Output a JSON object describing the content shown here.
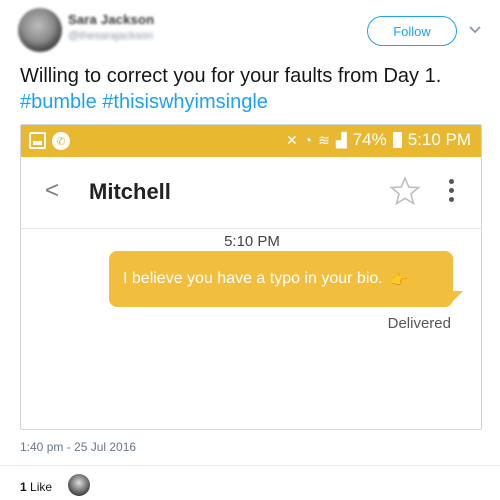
{
  "tweet": {
    "display_name": "Sara Jackson",
    "username": "@thesarajackson",
    "follow_label": "Follow",
    "text_before": "Willing to correct you for your faults from Day 1. ",
    "hashtags": [
      "#bumble",
      "#thisiswhyimsingle"
    ],
    "timestamp": "1:40 pm - 25 Jul 2016",
    "likes_count": "1",
    "likes_label": "Like"
  },
  "screenshot": {
    "status_bar": {
      "battery": "74%",
      "time": "5:10 PM",
      "color": "#e8b830"
    },
    "chat": {
      "contact_name": "Mitchell",
      "back_icon": "chevron-left-icon",
      "message_time": "5:10 PM",
      "message": "I believe you have a typo in your bio.",
      "bubble_color": "#f1be3e",
      "status": "Delivered"
    }
  },
  "colors": {
    "link": "#1da1f2",
    "muted": "#657786"
  }
}
